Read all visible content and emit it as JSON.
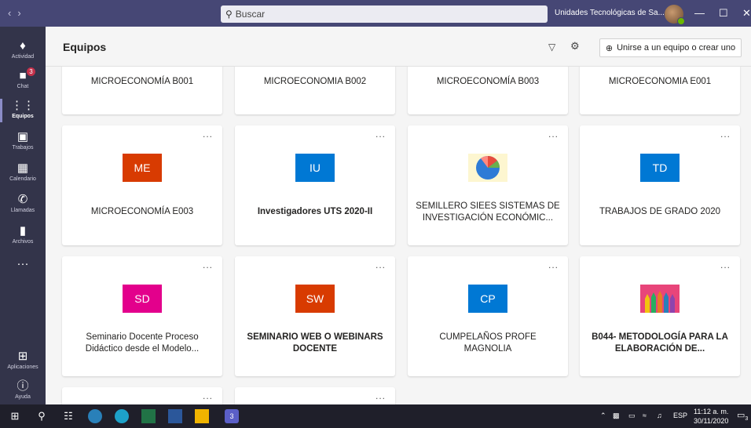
{
  "titlebar": {
    "search_placeholder": "Buscar",
    "org_name": "Unidades Tecnológicas de Sa...",
    "org_chevron": "⌄",
    "nav_back": "‹",
    "nav_forward": "›",
    "min": "—",
    "max": "☐",
    "close": "✕"
  },
  "rail": {
    "items": [
      {
        "label": "Actividad",
        "icon": "bell-icon",
        "glyph": "🔔"
      },
      {
        "label": "Chat",
        "icon": "chat-icon",
        "glyph": "💬",
        "badge": "3"
      },
      {
        "label": "Equipos",
        "icon": "teams-icon",
        "glyph": "👥"
      },
      {
        "label": "Trabajos",
        "icon": "briefcase-icon",
        "glyph": "💼"
      },
      {
        "label": "Calendario",
        "icon": "calendar-icon",
        "glyph": "📅"
      },
      {
        "label": "Llamadas",
        "icon": "phone-icon",
        "glyph": "📞"
      },
      {
        "label": "Archivos",
        "icon": "file-icon",
        "glyph": "📄"
      }
    ],
    "more": "···",
    "apps_label": "Aplicaciones",
    "help_label": "Ayuda"
  },
  "header": {
    "title": "Equipos",
    "join_label": "Unirse a un equipo o crear uno"
  },
  "teams": [
    {
      "name": "MICROECONOMÍA B001",
      "initials": "",
      "color": "",
      "bold": false
    },
    {
      "name": "MICROECONOMIA B002",
      "initials": "",
      "color": "",
      "bold": false
    },
    {
      "name": "MICROECONOMÍA B003",
      "initials": "",
      "color": "",
      "bold": false
    },
    {
      "name": "MICROECONOMIA E001",
      "initials": "",
      "color": "",
      "bold": false
    },
    {
      "name": "MICROECONOMÍA E003",
      "initials": "ME",
      "color": "#d83b01",
      "bold": false
    },
    {
      "name": "Investigadores UTS 2020-II",
      "initials": "IU",
      "color": "#0078d4",
      "bold": true
    },
    {
      "name": "SEMILLERO SIEES SISTEMAS DE INVESTIGACIÓN ECONÓMIC...",
      "initials": "",
      "color": "",
      "bold": false,
      "image": "pie-chart-image"
    },
    {
      "name": "TRABAJOS DE GRADO 2020",
      "initials": "TD",
      "color": "#0078d4",
      "bold": false
    },
    {
      "name": "Seminario Docente Proceso Didáctico desde el Modelo...",
      "initials": "SD",
      "color": "#e3008c",
      "bold": false
    },
    {
      "name": "SEMINARIO WEB O WEBINARS DOCENTE",
      "initials": "SW",
      "color": "#d83b01",
      "bold": true
    },
    {
      "name": "CUMPELAÑOS PROFE MAGNOLIA",
      "initials": "CP",
      "color": "#0078d4",
      "bold": false
    },
    {
      "name": "B044- METODOLOGÍA PARA LA ELABORACIÓN DE...",
      "initials": "",
      "color": "",
      "bold": true,
      "image": "pencils-image"
    },
    {
      "name": "",
      "initials": "",
      "color": "",
      "bold": false
    },
    {
      "name": "",
      "initials": "",
      "color": "",
      "bold": false
    }
  ],
  "card_more": "...",
  "taskbar": {
    "lang": "ESP",
    "time": "11:12 a. m.",
    "date": "30/11/2020",
    "notif_count": "3",
    "teams_badge": "3"
  }
}
